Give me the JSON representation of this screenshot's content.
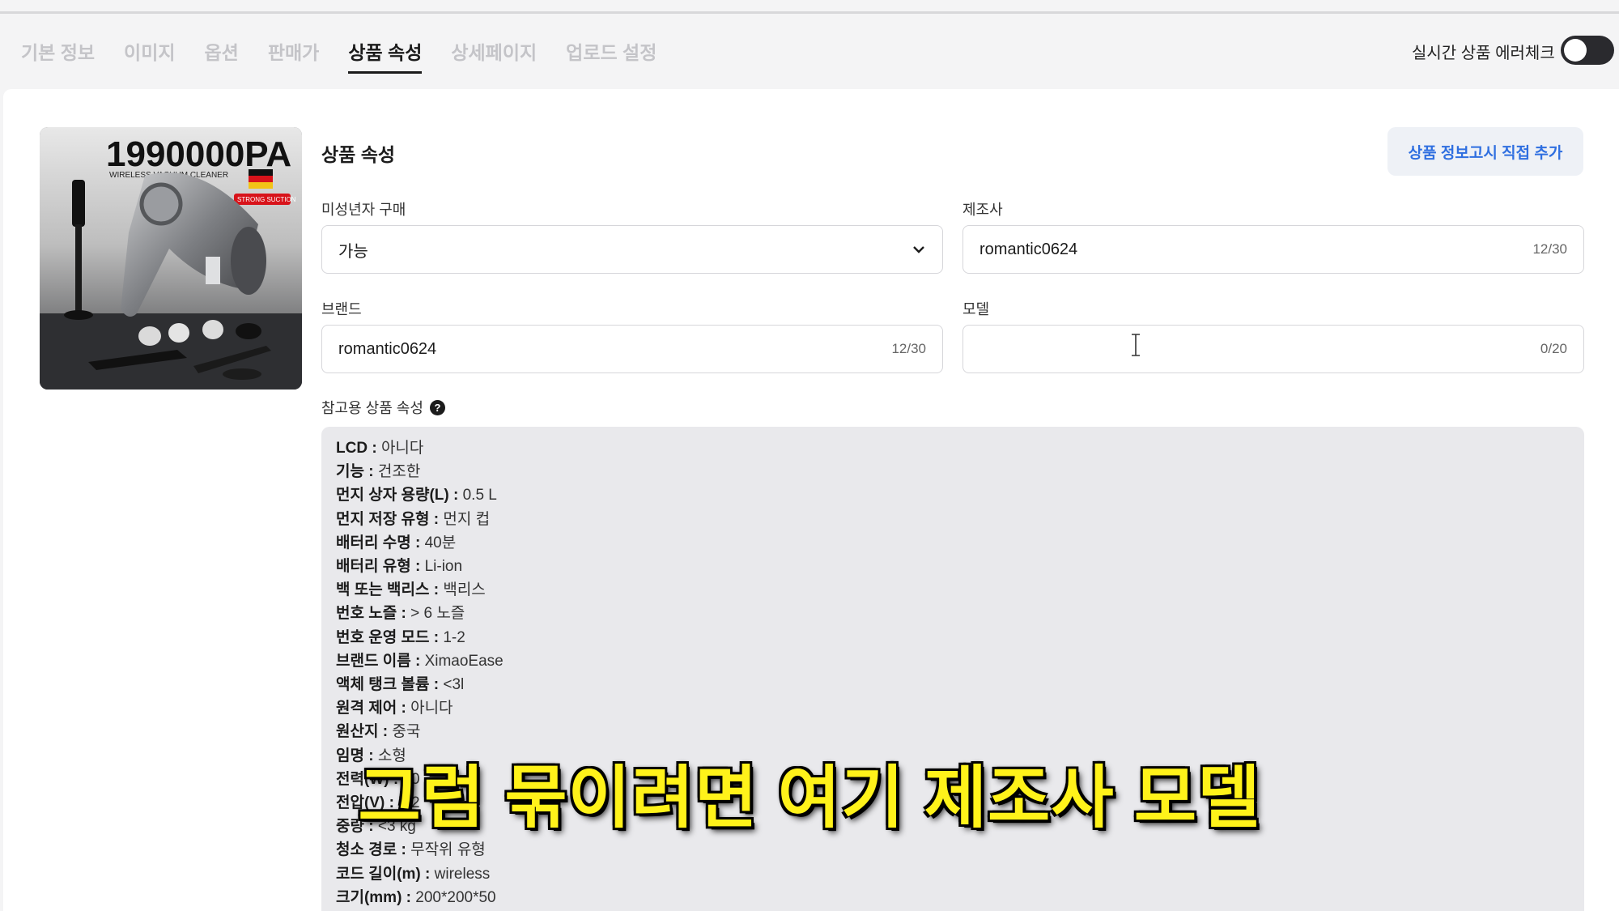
{
  "tabs": [
    "기본 정보",
    "이미지",
    "옵션",
    "판매가",
    "상품 속성",
    "상세페이지",
    "업로드 설정"
  ],
  "active_tab_index": 4,
  "error_check": {
    "label": "실시간 상품 에러체크",
    "enabled": false
  },
  "product_image": {
    "headline": "1990000PA",
    "caption": "WIRELESS VACUUM CLEANER",
    "badge": "STRONG SUCTION"
  },
  "section": {
    "title": "상품 속성",
    "add_button": "상품 정보고시 직접 추가"
  },
  "fields": {
    "minor_purchase": {
      "label": "미성년자 구매",
      "value": "가능"
    },
    "manufacturer": {
      "label": "제조사",
      "value": "romantic0624",
      "count": "12/30"
    },
    "brand": {
      "label": "브랜드",
      "value": "romantic0624",
      "count": "12/30"
    },
    "model": {
      "label": "모델",
      "value": "",
      "count": "0/20"
    }
  },
  "reference": {
    "label": "참고용 상품 속성",
    "items": [
      {
        "k": "LCD",
        "v": "아니다"
      },
      {
        "k": "기능",
        "v": "건조한"
      },
      {
        "k": "먼지 상자 용량(L)",
        "v": "0.5 L"
      },
      {
        "k": "먼지 저장 유형",
        "v": "먼지 컵"
      },
      {
        "k": "배터리 수명",
        "v": "40분"
      },
      {
        "k": "배터리 유형",
        "v": "Li-ion"
      },
      {
        "k": "백 또는 백리스",
        "v": "백리스"
      },
      {
        "k": "번호 노즐",
        "v": "> 6 노즐"
      },
      {
        "k": "번호 운영 모드",
        "v": "1-2"
      },
      {
        "k": "브랜드 이름",
        "v": "XimaoEase"
      },
      {
        "k": "액체 탱크 볼륨",
        "v": "<3l"
      },
      {
        "k": "원격 제어",
        "v": "아니다"
      },
      {
        "k": "원산지",
        "v": "중국"
      },
      {
        "k": "임명",
        "v": "소형"
      },
      {
        "k": "전력(W)",
        "v": "80"
      },
      {
        "k": "전압(V)",
        "v": "7.2"
      },
      {
        "k": "중량",
        "v": "<3 kg"
      },
      {
        "k": "청소 경로",
        "v": "무작위 유형"
      },
      {
        "k": "코드 길이(m)",
        "v": "wireless"
      },
      {
        "k": "크기(mm)",
        "v": "200*200*50"
      }
    ]
  },
  "subtitle": "그럼 묶이려면 여기 제조사 모델",
  "colors": {
    "accent": "#2f6fe0",
    "subtitle": "#fff21a",
    "toggle_off": "#2a2a2e"
  }
}
